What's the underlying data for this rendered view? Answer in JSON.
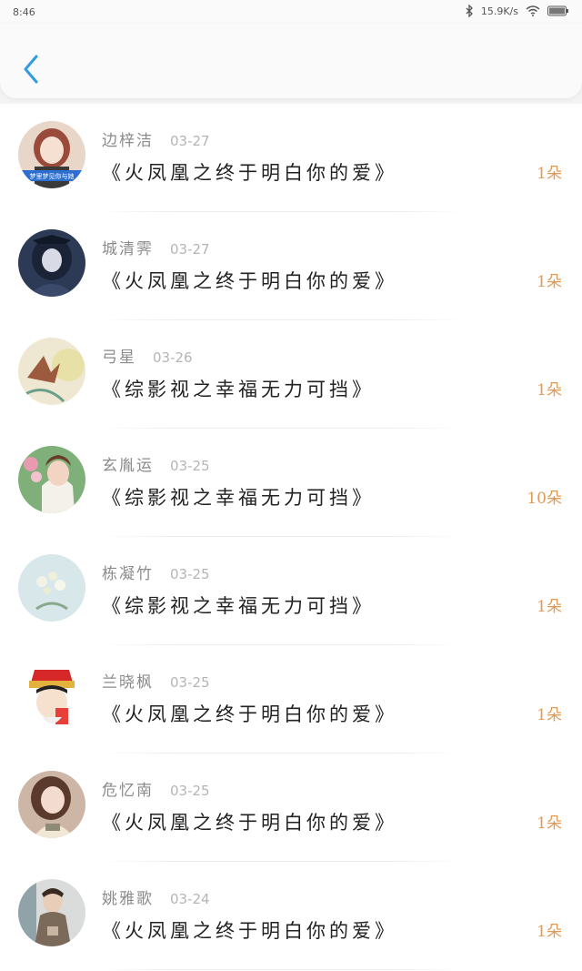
{
  "status_bar": {
    "time": "8:46",
    "net_speed": "15.9K/s"
  },
  "header": {
    "back_icon": "chevron-left-icon",
    "accent_color": "#2f9be3"
  },
  "gifts": [
    {
      "name": "边梓洁",
      "date": "03-27",
      "book": "《火凤凰之终于明白你的爱》",
      "count": "1朵",
      "avatar_caption": "梦里梦见你与她"
    },
    {
      "name": "城清霁",
      "date": "03-27",
      "book": "《火凤凰之终于明白你的爱》",
      "count": "1朵"
    },
    {
      "name": "弓星",
      "date": "03-26",
      "book": "《综影视之幸福无力可挡》",
      "count": "1朵"
    },
    {
      "name": "玄胤运",
      "date": "03-25",
      "book": "《综影视之幸福无力可挡》",
      "count": "10朵"
    },
    {
      "name": "栋凝竹",
      "date": "03-25",
      "book": "《综影视之幸福无力可挡》",
      "count": "1朵"
    },
    {
      "name": "兰晓枫",
      "date": "03-25",
      "book": "《火凤凰之终于明白你的爱》",
      "count": "1朵"
    },
    {
      "name": "危忆南",
      "date": "03-25",
      "book": "《火凤凰之终于明白你的爱》",
      "count": "1朵"
    },
    {
      "name": "姚雅歌",
      "date": "03-24",
      "book": "《火凤凰之终于明白你的爱》",
      "count": "1朵"
    }
  ],
  "colors": {
    "count": "#e09a56",
    "name": "#8b8b8b",
    "date": "#b5b5b5",
    "title": "#222222"
  }
}
